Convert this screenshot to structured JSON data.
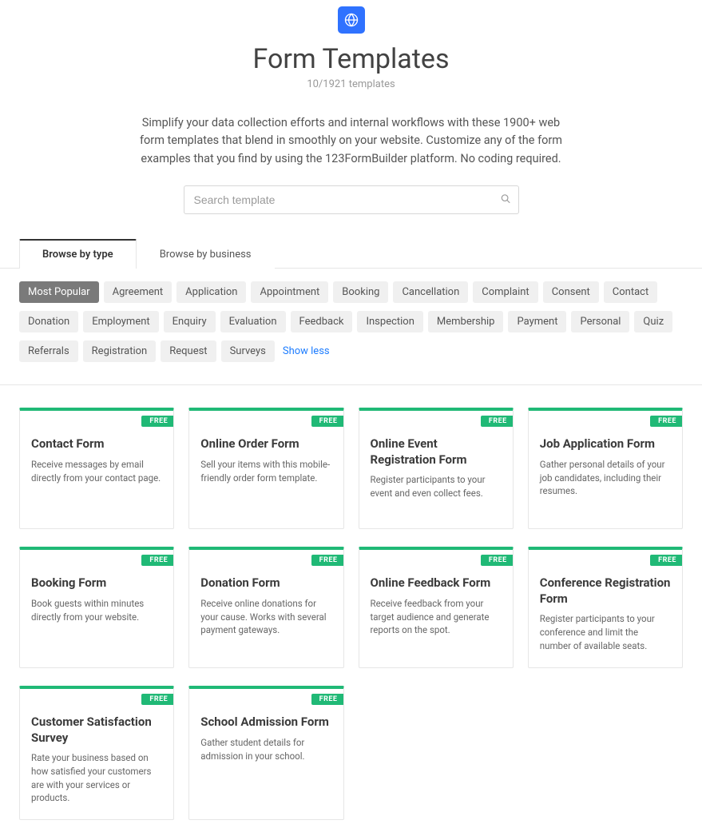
{
  "header": {
    "title": "Form Templates",
    "count_text": "10/1921 templates",
    "description": "Simplify your data collection efforts and internal workflows with these 1900+ web form templates that blend in smoothly on your website. Customize any of the form examples that you find by using the 123FormBuilder platform. No coding required."
  },
  "search": {
    "placeholder": "Search template"
  },
  "tabs": [
    {
      "label": "Browse by type",
      "active": true
    },
    {
      "label": "Browse by business",
      "active": false
    }
  ],
  "chips": {
    "items": [
      {
        "label": "Most Popular",
        "active": true
      },
      {
        "label": "Agreement"
      },
      {
        "label": "Application"
      },
      {
        "label": "Appointment"
      },
      {
        "label": "Booking"
      },
      {
        "label": "Cancellation"
      },
      {
        "label": "Complaint"
      },
      {
        "label": "Consent"
      },
      {
        "label": "Contact"
      },
      {
        "label": "Donation"
      },
      {
        "label": "Employment"
      },
      {
        "label": "Enquiry"
      },
      {
        "label": "Evaluation"
      },
      {
        "label": "Feedback"
      },
      {
        "label": "Inspection"
      },
      {
        "label": "Membership"
      },
      {
        "label": "Payment"
      },
      {
        "label": "Personal"
      },
      {
        "label": "Quiz"
      },
      {
        "label": "Referrals"
      },
      {
        "label": "Registration"
      },
      {
        "label": "Request"
      },
      {
        "label": "Surveys"
      }
    ],
    "toggle_label": "Show less"
  },
  "cards": [
    {
      "badge": "FREE",
      "title": "Contact Form",
      "desc": "Receive messages by email directly from your contact page."
    },
    {
      "badge": "FREE",
      "title": "Online Order Form",
      "desc": "Sell your items with this mobile-friendly order form template."
    },
    {
      "badge": "FREE",
      "title": "Online Event Registration Form",
      "desc": "Register participants to your event and even collect fees."
    },
    {
      "badge": "FREE",
      "title": "Job Application Form",
      "desc": "Gather personal details of your job candidates, including their resumes."
    },
    {
      "badge": "FREE",
      "title": "Booking Form",
      "desc": "Book guests within minutes directly from your website."
    },
    {
      "badge": "FREE",
      "title": "Donation Form",
      "desc": "Receive online donations for your cause. Works with several payment gateways."
    },
    {
      "badge": "FREE",
      "title": "Online Feedback Form",
      "desc": "Receive feedback from your target audience and generate reports on the spot."
    },
    {
      "badge": "FREE",
      "title": "Conference Registration Form",
      "desc": "Register participants to your conference and limit the number of available seats."
    },
    {
      "badge": "FREE",
      "title": "Customer Satisfaction Survey",
      "desc": "Rate your business based on how satisfied your customers are with your services or products."
    },
    {
      "badge": "FREE",
      "title": "School Admission Form",
      "desc": "Gather student details for admission in your school."
    }
  ]
}
